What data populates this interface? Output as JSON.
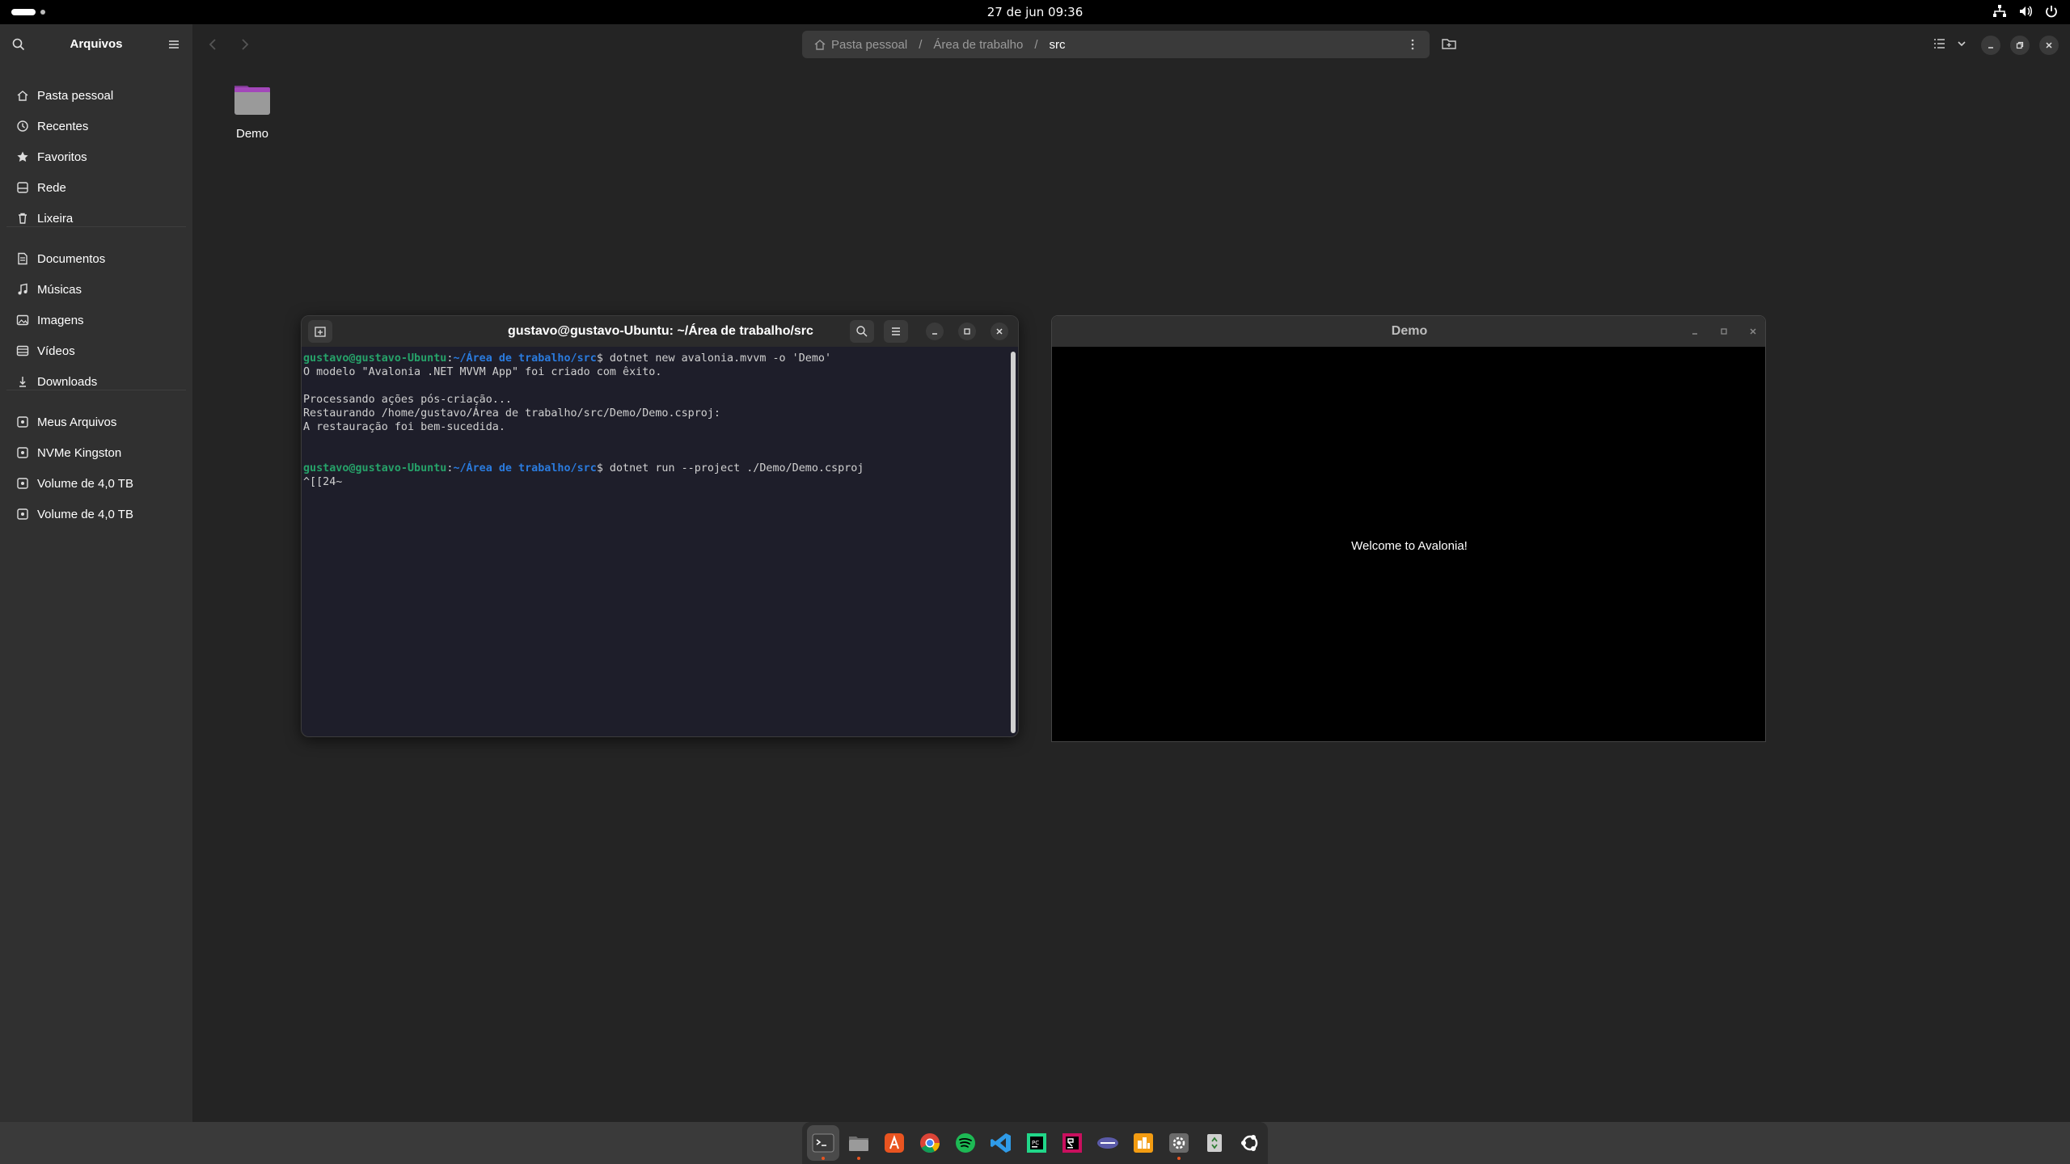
{
  "topbar": {
    "clock": "27 de jun  09:36"
  },
  "file_manager": {
    "sidebar_title": "Arquivos",
    "places": [
      {
        "label": "Pasta pessoal",
        "icon": "home-icon"
      },
      {
        "label": "Recentes",
        "icon": "history-icon"
      },
      {
        "label": "Favoritos",
        "icon": "star-icon"
      },
      {
        "label": "Rede",
        "icon": "network-icon"
      },
      {
        "label": "Lixeira",
        "icon": "trash-icon"
      }
    ],
    "bookmarks": [
      {
        "label": "Documentos",
        "icon": "document-icon"
      },
      {
        "label": "Músicas",
        "icon": "music-icon"
      },
      {
        "label": "Imagens",
        "icon": "image-icon"
      },
      {
        "label": "Vídeos",
        "icon": "video-icon"
      },
      {
        "label": "Downloads",
        "icon": "download-icon"
      }
    ],
    "devices": [
      {
        "label": "Meus Arquivos",
        "icon": "drive-icon"
      },
      {
        "label": "NVMe Kingston",
        "icon": "drive-icon"
      },
      {
        "label": "Volume de 4,0 TB",
        "icon": "drive-icon"
      },
      {
        "label": "Volume de 4,0 TB",
        "icon": "drive-icon"
      }
    ],
    "path": {
      "home": "Pasta pessoal",
      "sep": "/",
      "middle": "Área de trabalho",
      "current": "src"
    },
    "folders": [
      {
        "name": "Demo",
        "color": "#a347ba"
      }
    ]
  },
  "terminal": {
    "title": "gustavo@gustavo-Ubuntu: ~/Área de trabalho/src",
    "prompt_user": "gustavo@gustavo-Ubuntu",
    "prompt_colon": ":",
    "prompt_path": "~/Área de trabalho/src",
    "prompt_dollar": "$",
    "cmd1": " dotnet new avalonia.mvvm -o 'Demo'",
    "out1": "O modelo \"Avalonia .NET MVVM App\" foi criado com êxito.",
    "out2": "Processando ações pós-criação...",
    "out3": "Restaurando /home/gustavo/Área de trabalho/src/Demo/Demo.csproj:",
    "out4": "A restauração foi bem-sucedida.",
    "cmd2": " dotnet run --project ./Demo/Demo.csproj",
    "out5": "^[[24~"
  },
  "demo_window": {
    "title": "Demo",
    "body_text": "Welcome to Avalonia!"
  },
  "dock": [
    {
      "name": "terminal",
      "icon": "terminal-icon",
      "active": true
    },
    {
      "name": "files",
      "icon": "files-icon"
    },
    {
      "name": "app-center",
      "icon": "app-center-icon"
    },
    {
      "name": "chrome",
      "icon": "chrome-icon"
    },
    {
      "name": "spotify",
      "icon": "spotify-icon"
    },
    {
      "name": "vscode",
      "icon": "vscode-icon"
    },
    {
      "name": "pycharm",
      "icon": "pycharm-icon"
    },
    {
      "name": "rider",
      "icon": "rider-icon"
    },
    {
      "name": "editor",
      "icon": "editor-icon"
    },
    {
      "name": "ubuntu-software",
      "icon": "ubuntu-software-icon"
    },
    {
      "name": "settings",
      "icon": "settings-icon"
    },
    {
      "name": "recycle",
      "icon": "recycle-icon"
    },
    {
      "name": "apps",
      "icon": "ubuntu-logo-icon"
    }
  ],
  "colors": {
    "accent": "#e95420",
    "terminal_user": "#26a269",
    "terminal_path": "#2a7bde",
    "folder": "#a347ba"
  }
}
